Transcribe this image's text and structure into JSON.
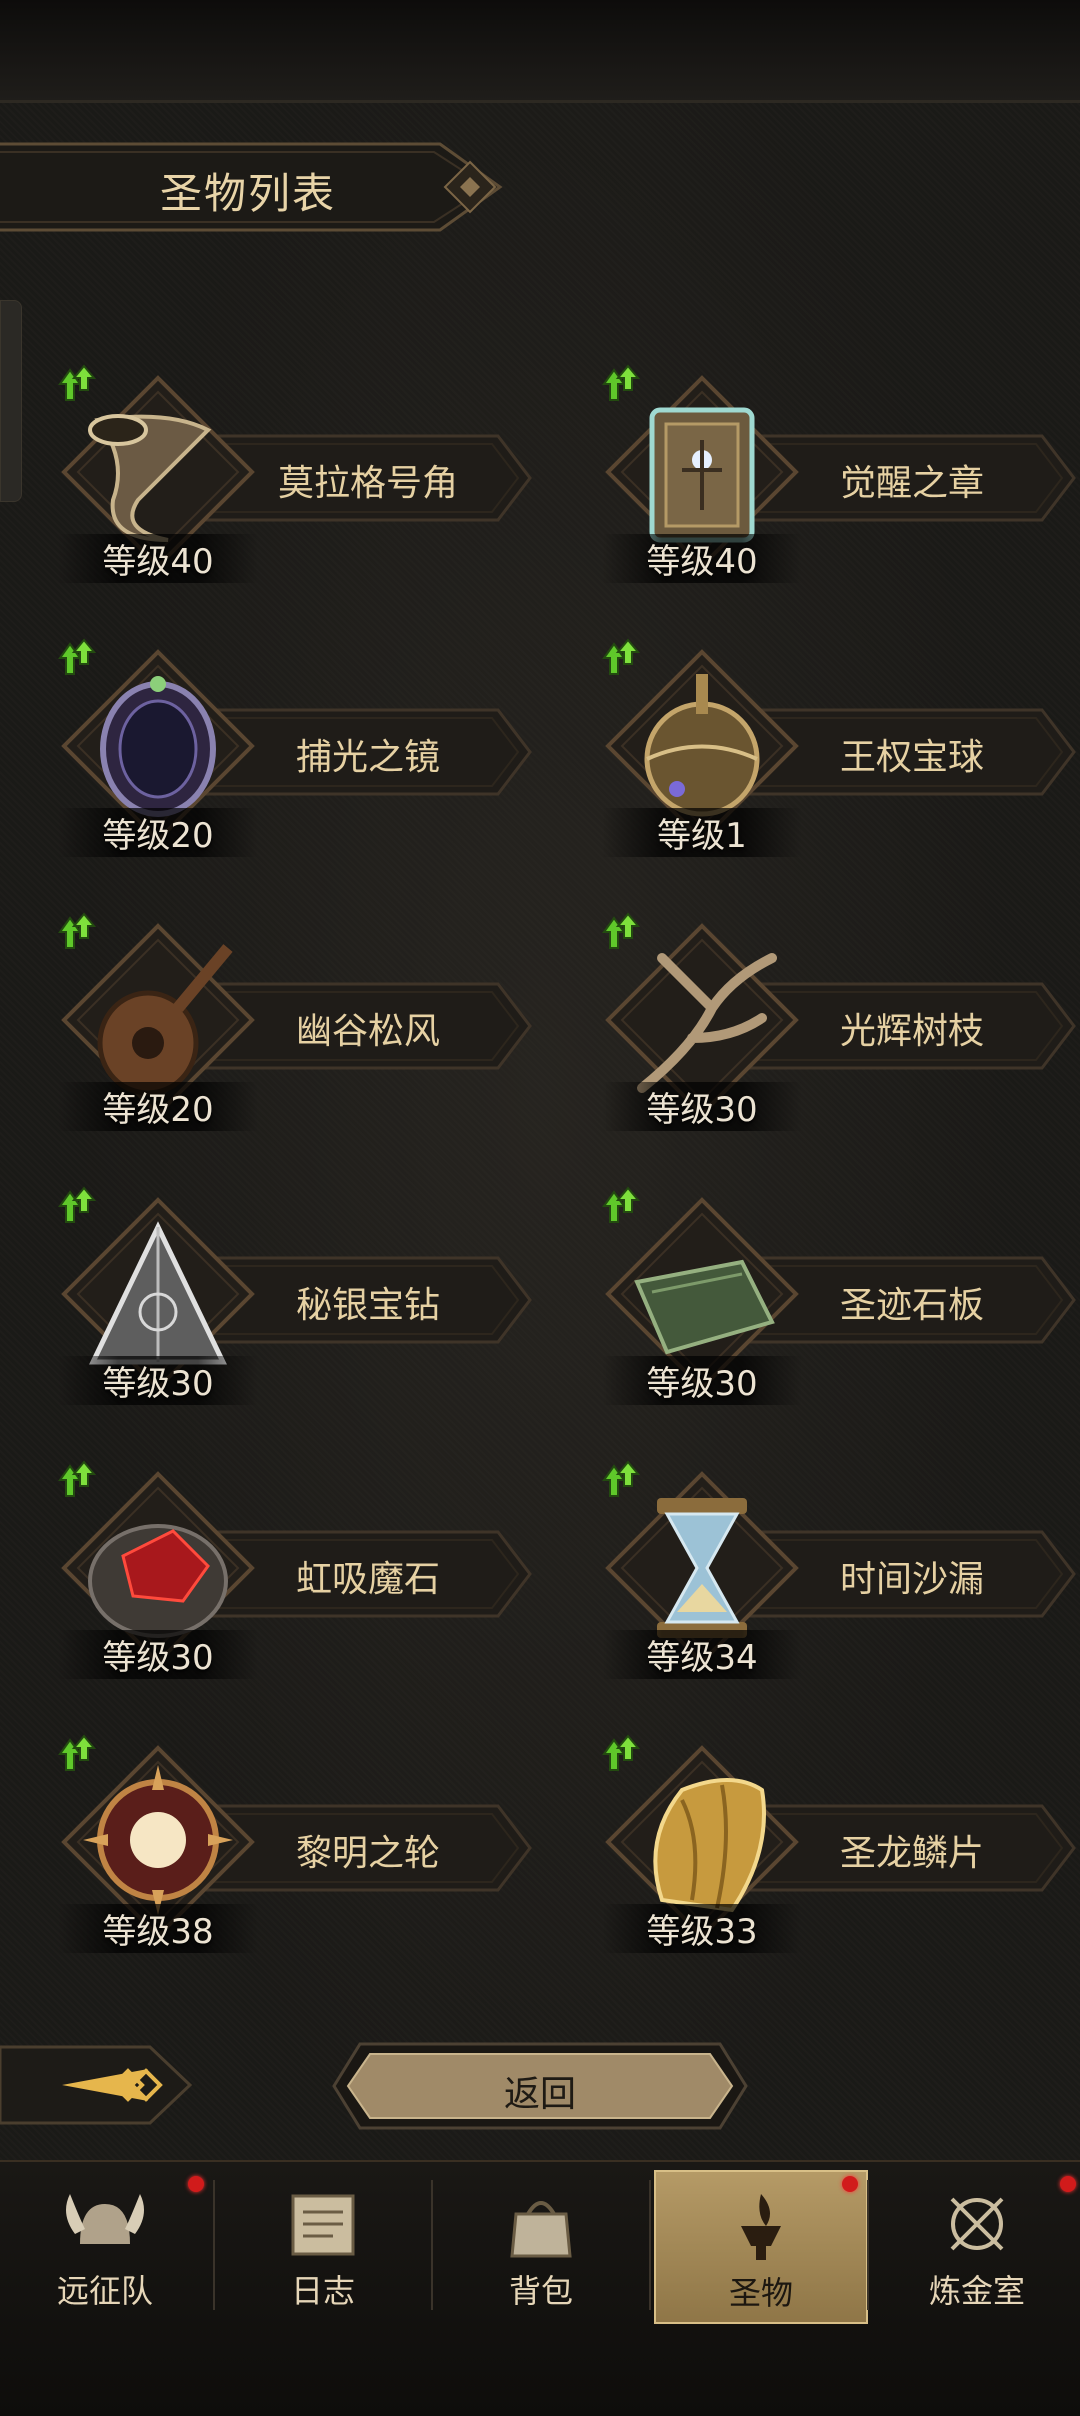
{
  "header": {
    "title": "圣物列表"
  },
  "relics": [
    {
      "name": "莫拉格号角",
      "level": "等级40",
      "icon": "horn-icon"
    },
    {
      "name": "觉醒之章",
      "level": "等级40",
      "icon": "tome-icon"
    },
    {
      "name": "捕光之镜",
      "level": "等级20",
      "icon": "mirror-icon"
    },
    {
      "name": "王权宝球",
      "level": "等级1",
      "icon": "orb-icon"
    },
    {
      "name": "幽谷松风",
      "level": "等级20",
      "icon": "lute-icon"
    },
    {
      "name": "光辉树枝",
      "level": "等级30",
      "icon": "branch-icon"
    },
    {
      "name": "秘银宝钻",
      "level": "等级30",
      "icon": "pyramid-icon"
    },
    {
      "name": "圣迹石板",
      "level": "等级30",
      "icon": "stone-tablet-icon"
    },
    {
      "name": "虹吸魔石",
      "level": "等级30",
      "icon": "red-stone-icon"
    },
    {
      "name": "时间沙漏",
      "level": "等级34",
      "icon": "hourglass-icon"
    },
    {
      "name": "黎明之轮",
      "level": "等级38",
      "icon": "sun-wheel-icon"
    },
    {
      "name": "圣龙鳞片",
      "level": "等级33",
      "icon": "dragon-scale-icon"
    }
  ],
  "actions": {
    "back_label": "返回"
  },
  "nav": [
    {
      "label": "远征队",
      "icon": "viking-helmet-icon",
      "badge": true
    },
    {
      "label": "日志",
      "icon": "scroll-icon",
      "badge": false
    },
    {
      "label": "背包",
      "icon": "bag-icon",
      "badge": false
    },
    {
      "label": "圣物",
      "icon": "brazier-icon",
      "badge": true,
      "active": true
    },
    {
      "label": "炼金室",
      "icon": "alchemy-icon",
      "badge": true
    }
  ],
  "colors": {
    "accent": "#b59a66",
    "text": "#e6d1a3",
    "badge": "#d11b1b",
    "upgrade": "#5fc82a"
  }
}
